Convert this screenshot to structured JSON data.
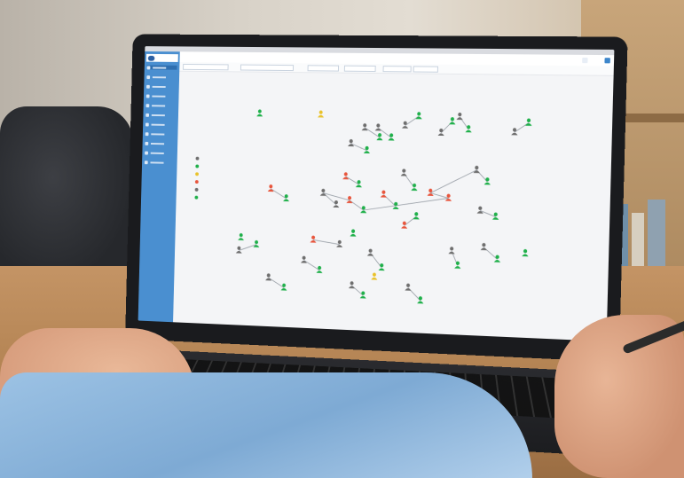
{
  "app": {
    "logo_text": "",
    "page_title": "",
    "header_buttons": [
      "",
      ""
    ],
    "filters": [
      "",
      "",
      "",
      "",
      "",
      ""
    ],
    "graph_title": ""
  },
  "sidebar": {
    "items": [
      {
        "icon": "home-icon",
        "active": true
      },
      {
        "icon": "dashboard-icon"
      },
      {
        "icon": "users-icon"
      },
      {
        "icon": "settings-icon"
      },
      {
        "icon": "phone-icon"
      },
      {
        "icon": "chart-icon"
      },
      {
        "icon": "list-icon"
      },
      {
        "icon": "calendar-icon"
      },
      {
        "icon": "document-icon"
      },
      {
        "icon": "tools-icon"
      },
      {
        "icon": "help-icon"
      }
    ]
  },
  "legend": {
    "colors": [
      "#6e6e6e",
      "#1fb04a",
      "#e9c22b",
      "#e8553c",
      "#6e6e6e",
      "#1fb04a"
    ]
  },
  "colors": {
    "accent": "#4a8fd0",
    "online": "#1fb04a",
    "warning": "#e9c22b",
    "alert": "#e8553c",
    "offline": "#6e6e6e"
  },
  "graph": {
    "nodes": [
      {
        "s": "green"
      },
      {
        "s": "grey"
      },
      {
        "s": "green"
      },
      {
        "s": "grey"
      },
      {
        "s": "green"
      },
      {
        "s": "yellow"
      },
      {
        "s": "grey"
      },
      {
        "s": "green"
      },
      {
        "s": "grey"
      },
      {
        "s": "green"
      },
      {
        "s": "grey"
      },
      {
        "s": "green"
      },
      {
        "s": "red"
      },
      {
        "s": "green"
      },
      {
        "s": "grey"
      },
      {
        "s": "green"
      },
      {
        "s": "grey"
      },
      {
        "s": "green"
      },
      {
        "s": "red"
      },
      {
        "s": "green"
      },
      {
        "s": "grey"
      },
      {
        "s": "grey"
      },
      {
        "s": "red"
      },
      {
        "s": "green"
      },
      {
        "s": "red"
      },
      {
        "s": "green"
      },
      {
        "s": "red"
      },
      {
        "s": "red"
      },
      {
        "s": "grey"
      },
      {
        "s": "green"
      },
      {
        "s": "grey"
      },
      {
        "s": "green"
      },
      {
        "s": "green"
      },
      {
        "s": "grey"
      },
      {
        "s": "green"
      },
      {
        "s": "red"
      },
      {
        "s": "grey"
      },
      {
        "s": "green"
      },
      {
        "s": "grey"
      },
      {
        "s": "green"
      },
      {
        "s": "red"
      },
      {
        "s": "green"
      },
      {
        "s": "grey"
      },
      {
        "s": "green"
      },
      {
        "s": "grey"
      },
      {
        "s": "green"
      },
      {
        "s": "grey"
      },
      {
        "s": "green"
      },
      {
        "s": "yellow"
      },
      {
        "s": "grey"
      },
      {
        "s": "green"
      },
      {
        "s": "grey"
      },
      {
        "s": "green"
      },
      {
        "s": "green"
      },
      {
        "s": "grey"
      },
      {
        "s": "green"
      },
      {
        "s": "grey"
      },
      {
        "s": "green"
      }
    ],
    "edges": [
      [
        1,
        2
      ],
      [
        3,
        4
      ],
      [
        6,
        7
      ],
      [
        8,
        9
      ],
      [
        10,
        11
      ],
      [
        12,
        13
      ],
      [
        14,
        15
      ],
      [
        16,
        17
      ],
      [
        18,
        19
      ],
      [
        20,
        21
      ],
      [
        22,
        23
      ],
      [
        24,
        25
      ],
      [
        26,
        27
      ],
      [
        28,
        29
      ],
      [
        30,
        31
      ],
      [
        33,
        34
      ],
      [
        35,
        36
      ],
      [
        38,
        39
      ],
      [
        40,
        41
      ],
      [
        42,
        43
      ],
      [
        44,
        45
      ],
      [
        46,
        47
      ],
      [
        49,
        50
      ],
      [
        51,
        52
      ],
      [
        54,
        55
      ],
      [
        56,
        57
      ],
      [
        20,
        22
      ],
      [
        27,
        23
      ],
      [
        28,
        26
      ]
    ]
  }
}
